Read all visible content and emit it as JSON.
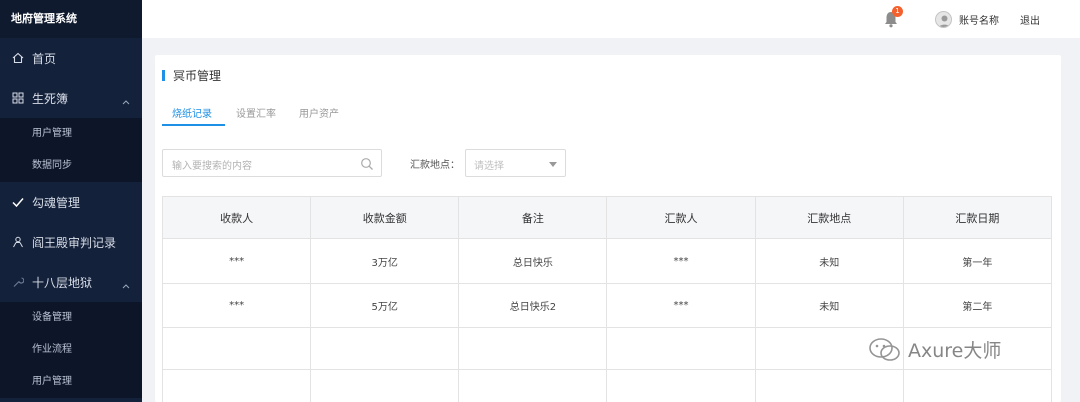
{
  "app": {
    "title": "地府管理系统"
  },
  "sidebar": {
    "items": [
      {
        "label": "首页",
        "icon": "home-icon"
      },
      {
        "label": "生死簿",
        "icon": "grid-icon",
        "expanded": true,
        "children": [
          "用户管理",
          "数据同步"
        ]
      },
      {
        "label": "勾魂管理",
        "icon": "check-icon"
      },
      {
        "label": "阎王殿审判记录",
        "icon": "person-icon"
      },
      {
        "label": "十八层地狱",
        "icon": "tool-icon",
        "expanded": true,
        "children": [
          "设备管理",
          "作业流程",
          "用户管理"
        ]
      }
    ]
  },
  "header": {
    "notification_count": "1",
    "account_name": "账号名称",
    "logout_label": "退出"
  },
  "page": {
    "title": "冥币管理",
    "tabs": [
      {
        "label": "烧纸记录",
        "active": true
      },
      {
        "label": "设置汇率",
        "active": false
      },
      {
        "label": "用户资产",
        "active": false
      }
    ],
    "search_placeholder": "输入要搜索的内容",
    "location_label": "汇款地点：",
    "location_placeholder": "请选择",
    "table": {
      "columns": [
        "收款人",
        "收款金额",
        "备注",
        "汇款人",
        "汇款地点",
        "汇款日期"
      ],
      "rows": [
        [
          "***",
          "3万亿",
          "总日快乐",
          "***",
          "未知",
          "第一年"
        ],
        [
          "***",
          "5万亿",
          "总日快乐2",
          "***",
          "未知",
          "第二年"
        ]
      ]
    }
  },
  "watermark": {
    "text": "Axure大师"
  },
  "colors": {
    "accent": "#1e90e6",
    "sidebar": "#14213a",
    "badge": "#f5612e"
  }
}
